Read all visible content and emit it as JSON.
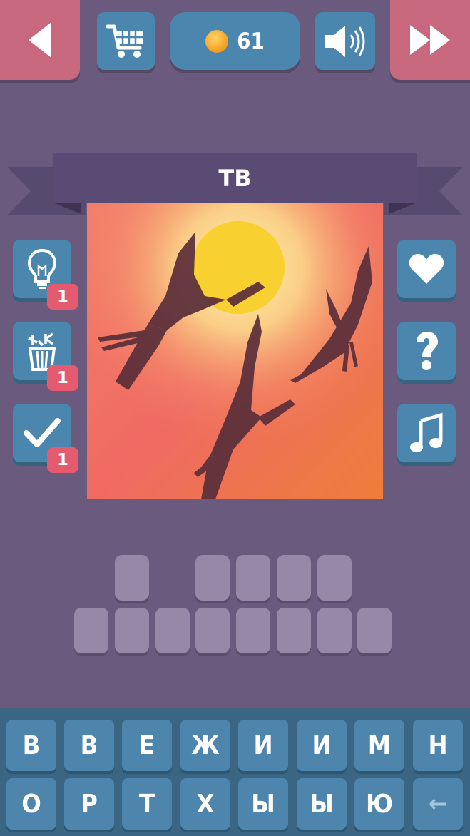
{
  "header": {
    "coins": "61"
  },
  "category_title": "ТВ",
  "hints": [
    {
      "name": "hint-lightbulb",
      "count": "1"
    },
    {
      "name": "hint-remove-letters",
      "count": "1"
    },
    {
      "name": "hint-reveal-answer",
      "count": "1"
    }
  ],
  "answer": {
    "word1_length": 1,
    "word2_length": 4,
    "word3_length": 8
  },
  "keyboard": {
    "row1": [
      "В",
      "В",
      "Е",
      "Ж",
      "И",
      "И",
      "М",
      "Н"
    ],
    "row2": [
      "О",
      "Р",
      "Т",
      "Х",
      "Ы",
      "Ы",
      "Ю"
    ],
    "delete_symbol": "←"
  },
  "colors": {
    "background": "#6a5a7e",
    "accent_blue": "#4a86ae",
    "accent_pink": "#c8687e",
    "badge": "#e45a6e",
    "ribbon": "#5a4b74",
    "slot": "#9888a8"
  }
}
